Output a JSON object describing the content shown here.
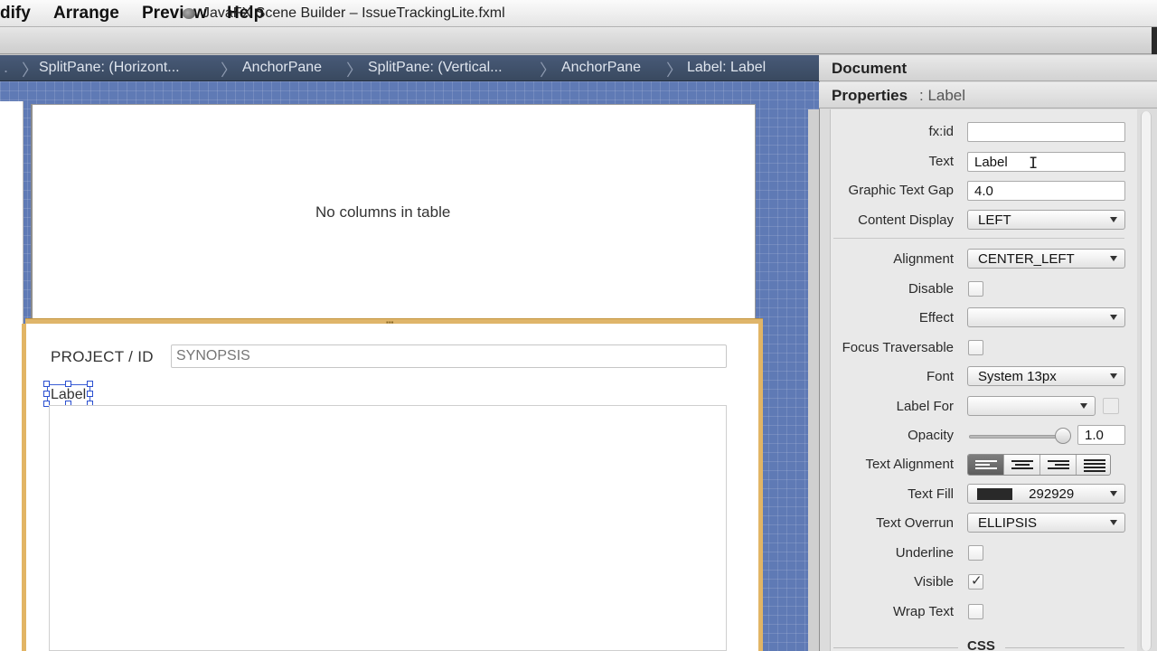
{
  "menubar": {
    "items": [
      "dify",
      "Arrange",
      "Preview",
      "Help"
    ]
  },
  "window": {
    "title": "JavaFX Scene Builder – IssueTrackingLite.fxml"
  },
  "breadcrumb": {
    "items": [
      "SplitPane: (Horizont...",
      "AnchorPane",
      "SplitPane: (Vertical...",
      "AnchorPane",
      "Label: Label"
    ]
  },
  "canvas": {
    "table_placeholder": "No columns in table",
    "project_label": "PROJECT  /  ID",
    "synopsis_placeholder": "SYNOPSIS",
    "selected_label_text": "Label"
  },
  "panel": {
    "document_title": "Document",
    "properties_title": "Properties",
    "properties_target": ": Label",
    "properties": {
      "fx_id": {
        "label": "fx:id",
        "value": ""
      },
      "text": {
        "label": "Text",
        "value": "Label"
      },
      "graphic_text_gap": {
        "label": "Graphic Text Gap",
        "value": "4.0"
      },
      "content_display": {
        "label": "Content Display",
        "value": "LEFT"
      },
      "alignment": {
        "label": "Alignment",
        "value": "CENTER_LEFT"
      },
      "disable": {
        "label": "Disable",
        "checked": false
      },
      "effect": {
        "label": "Effect",
        "value": ""
      },
      "focus_traversable": {
        "label": "Focus Traversable",
        "checked": false
      },
      "font": {
        "label": "Font",
        "value": "System 13px"
      },
      "label_for": {
        "label": "Label For",
        "value": ""
      },
      "opacity": {
        "label": "Opacity",
        "value": "1.0",
        "level": 1.0
      },
      "text_alignment": {
        "label": "Text Alignment",
        "selected": "left",
        "options": [
          "left",
          "center",
          "right",
          "justify"
        ]
      },
      "text_fill": {
        "label": "Text Fill",
        "value": "292929",
        "color": "#292929"
      },
      "text_overrun": {
        "label": "Text Overrun",
        "value": "ELLIPSIS"
      },
      "underline": {
        "label": "Underline",
        "checked": false
      },
      "visible": {
        "label": "Visible",
        "checked": true
      },
      "wrap_text": {
        "label": "Wrap Text",
        "checked": false
      }
    },
    "css_section": "CSS"
  },
  "colors": {
    "breadcrumb_bg": "#485a78",
    "canvas_bg": "#5f7ab5",
    "selection_border": "#e2b565",
    "selection_handle": "#2a4fd0"
  }
}
